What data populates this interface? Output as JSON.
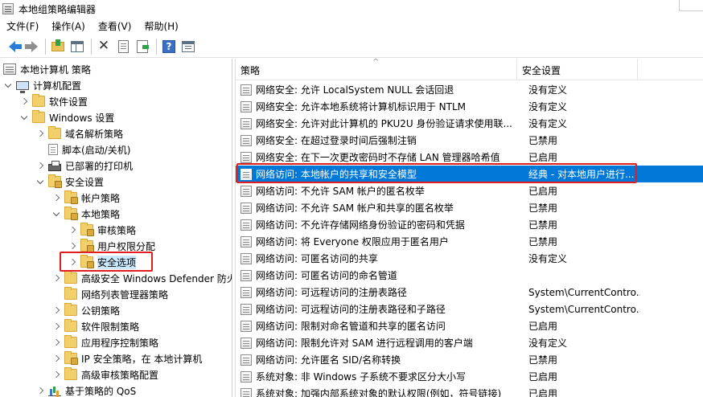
{
  "window": {
    "title": "本地组策略编辑器"
  },
  "menu": [
    "文件(F)",
    "操作(A)",
    "查看(V)",
    "帮助(H)"
  ],
  "toolbar": {
    "icons": [
      "back-icon",
      "forward-icon",
      "up-folder-icon",
      "show-hide-tree-icon",
      "delete-icon",
      "properties-icon",
      "export-list-icon",
      "help-icon",
      "show-action-pane-icon"
    ]
  },
  "tree": [
    {
      "label": "本地计算机 策略",
      "icon": "policy"
    },
    {
      "label": "计算机配置",
      "icon": "computer"
    },
    {
      "label": "软件设置",
      "icon": "folder"
    },
    {
      "label": "Windows 设置",
      "icon": "folder"
    },
    {
      "label": "域名解析策略",
      "icon": "folder"
    },
    {
      "label": "脚本(启动/关机)",
      "icon": "doc"
    },
    {
      "label": "已部署的打印机",
      "icon": "printer"
    },
    {
      "label": "安全设置",
      "icon": "folder-lock"
    },
    {
      "label": "帐户策略",
      "icon": "folder-lock"
    },
    {
      "label": "本地策略",
      "icon": "folder-lock"
    },
    {
      "label": "审核策略",
      "icon": "folder-lock"
    },
    {
      "label": "用户权限分配",
      "icon": "folder-lock"
    },
    {
      "label": "安全选项",
      "icon": "folder-lock"
    },
    {
      "label": "高级安全 Windows Defender 防火",
      "icon": "folder"
    },
    {
      "label": "网络列表管理器策略",
      "icon": "folder"
    },
    {
      "label": "公钥策略",
      "icon": "folder"
    },
    {
      "label": "软件限制策略",
      "icon": "folder"
    },
    {
      "label": "应用程序控制策略",
      "icon": "folder"
    },
    {
      "label": "IP 安全策略，在 本地计算机",
      "icon": "folder-lock"
    },
    {
      "label": "高级审核策略配置",
      "icon": "folder"
    },
    {
      "label": "基于策略的 QoS",
      "icon": "chart"
    }
  ],
  "list": {
    "columns": {
      "policy": "策略",
      "setting": "安全设置"
    },
    "rows": [
      {
        "policy": "网络安全: 允许 LocalSystem NULL 会话回退",
        "setting": "没有定义"
      },
      {
        "policy": "网络安全: 允许本地系统将计算机标识用于 NTLM",
        "setting": "没有定义"
      },
      {
        "policy": "网络安全: 允许对此计算机的 PKU2U 身份验证请求使用联...",
        "setting": "没有定义"
      },
      {
        "policy": "网络安全: 在超过登录时间后强制注销",
        "setting": "已禁用"
      },
      {
        "policy": "网络安全: 在下一次更改密码时不存储 LAN 管理器哈希值",
        "setting": "已启用"
      },
      {
        "policy": "网络访问: 本地帐户的共享和安全模型",
        "setting": "经典 - 对本地用户进行..."
      },
      {
        "policy": "网络访问: 不允许 SAM 帐户的匿名枚举",
        "setting": "已启用"
      },
      {
        "policy": "网络访问: 不允许 SAM 帐户和共享的匿名枚举",
        "setting": "已禁用"
      },
      {
        "policy": "网络访问: 不允许存储网络身份验证的密码和凭据",
        "setting": "已禁用"
      },
      {
        "policy": "网络访问: 将 Everyone 权限应用于匿名用户",
        "setting": "已禁用"
      },
      {
        "policy": "网络访问: 可匿名访问的共享",
        "setting": "没有定义"
      },
      {
        "policy": "网络访问: 可匿名访问的命名管道",
        "setting": ""
      },
      {
        "policy": "网络访问: 可远程访问的注册表路径",
        "setting": "System\\CurrentContro..."
      },
      {
        "policy": "网络访问: 可远程访问的注册表路径和子路径",
        "setting": "System\\CurrentContro..."
      },
      {
        "policy": "网络访问: 限制对命名管道和共享的匿名访问",
        "setting": "已启用"
      },
      {
        "policy": "网络访问: 限制允许对 SAM 进行远程调用的客户端",
        "setting": "没有定义"
      },
      {
        "policy": "网络访问: 允许匿名 SID/名称转换",
        "setting": "已禁用"
      },
      {
        "policy": "系统对象: 非 Windows 子系统不要求区分大小写",
        "setting": "已启用"
      },
      {
        "policy": "系统对象: 加强内部系统对象的默认权限(例如，符号链接)",
        "setting": "已启用"
      }
    ]
  },
  "colors": {
    "selection": "#0078d7",
    "highlight_box": "#e02020",
    "tree_selection": "#cce8ff"
  }
}
